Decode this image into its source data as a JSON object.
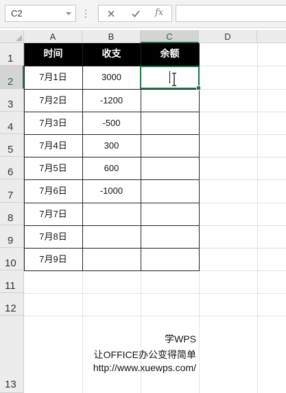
{
  "formula_bar": {
    "name_box": "C2",
    "fx_label": "fx",
    "formula_value": ""
  },
  "columns": [
    "A",
    "B",
    "C",
    "D"
  ],
  "rows": [
    "1",
    "2",
    "3",
    "4",
    "5",
    "6",
    "7",
    "8",
    "9",
    "10",
    "11",
    "12",
    "13"
  ],
  "selected_cell": "C2",
  "table": {
    "headers": [
      "时间",
      "收支",
      "余额"
    ],
    "rows": [
      {
        "date": "7月1日",
        "amount": "3000",
        "balance": ""
      },
      {
        "date": "7月2日",
        "amount": "-1200",
        "balance": ""
      },
      {
        "date": "7月3日",
        "amount": "-500",
        "balance": ""
      },
      {
        "date": "7月4日",
        "amount": "300",
        "balance": ""
      },
      {
        "date": "7月5日",
        "amount": "600",
        "balance": ""
      },
      {
        "date": "7月6日",
        "amount": "-1000",
        "balance": ""
      },
      {
        "date": "7月7日",
        "amount": "",
        "balance": ""
      },
      {
        "date": "7月8日",
        "amount": "",
        "balance": ""
      },
      {
        "date": "7月9日",
        "amount": "",
        "balance": ""
      }
    ]
  },
  "watermark": {
    "line1": "学WPS",
    "line2": "让OFFICE办公变得简单",
    "line3": "http://www.xuewps.com/"
  },
  "colors": {
    "accent": "#217346",
    "header_fill": "#000000"
  }
}
